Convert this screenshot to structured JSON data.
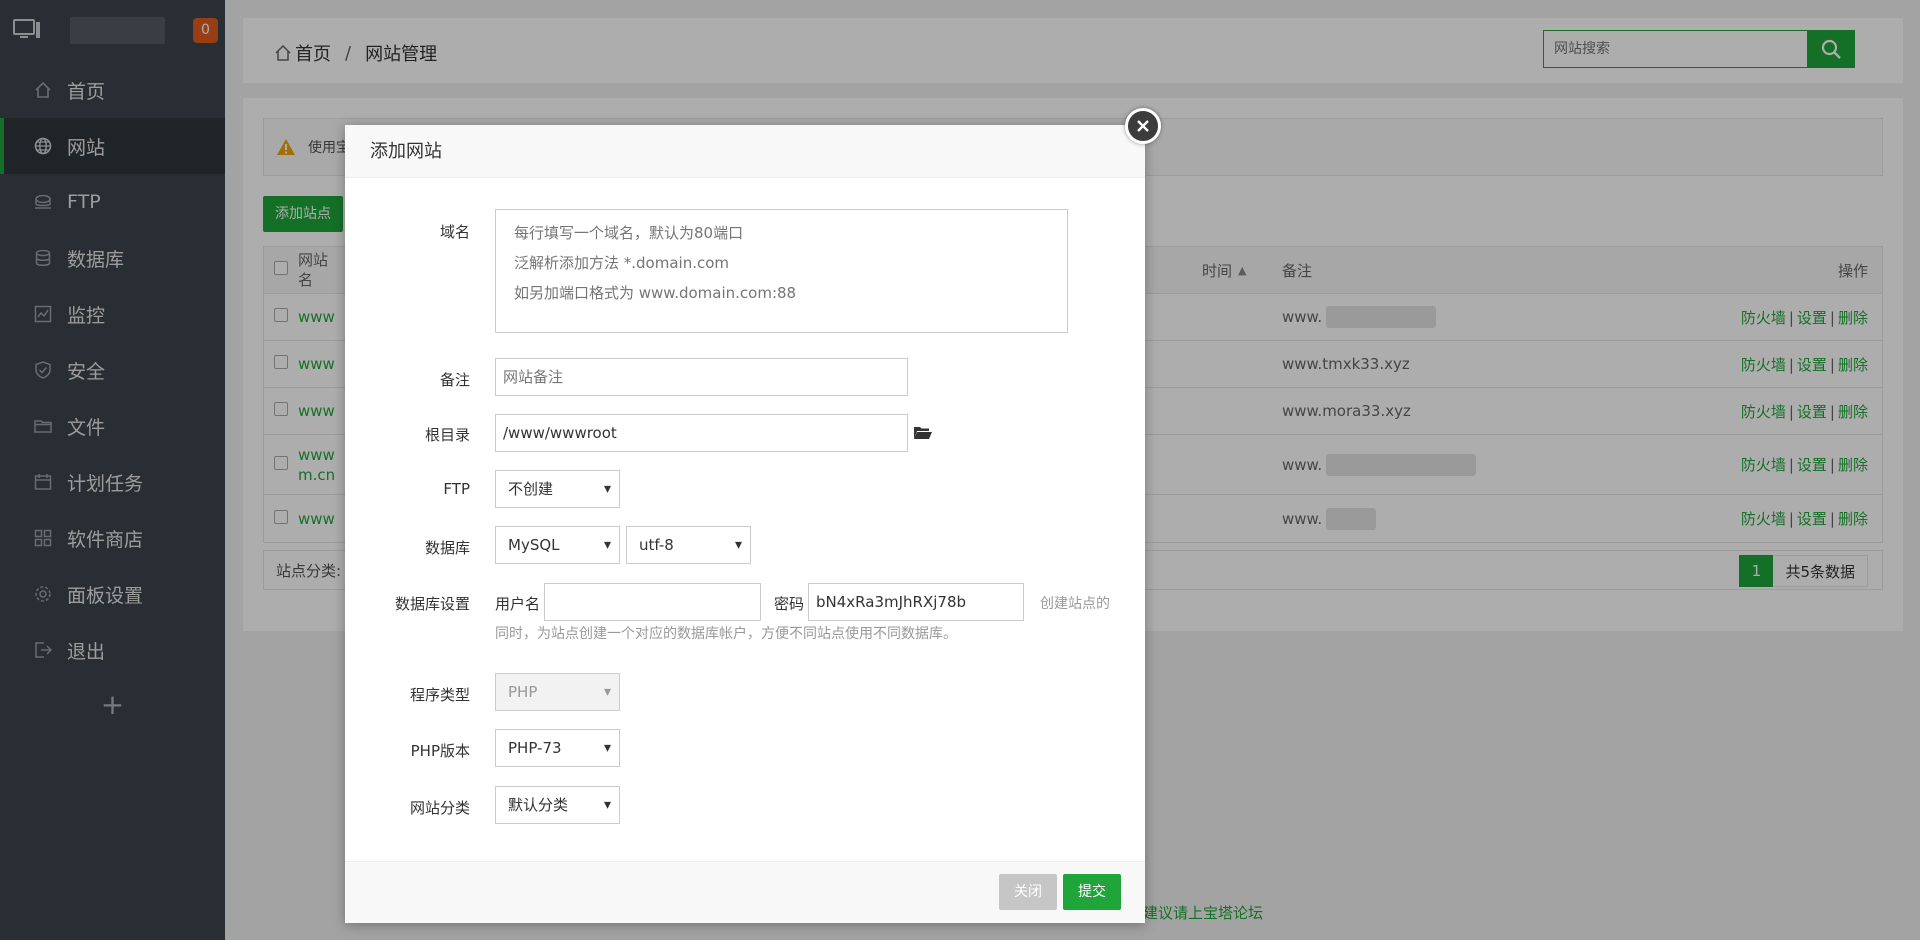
{
  "sidebar": {
    "badge": "0",
    "items": [
      {
        "label": "首页",
        "icon": "home-icon"
      },
      {
        "label": "网站",
        "icon": "globe-icon"
      },
      {
        "label": "FTP",
        "icon": "ftp-icon"
      },
      {
        "label": "数据库",
        "icon": "database-icon"
      },
      {
        "label": "监控",
        "icon": "monitor-icon"
      },
      {
        "label": "安全",
        "icon": "shield-icon"
      },
      {
        "label": "文件",
        "icon": "folder-icon"
      },
      {
        "label": "计划任务",
        "icon": "calendar-icon"
      },
      {
        "label": "软件商店",
        "icon": "grid-icon"
      },
      {
        "label": "面板设置",
        "icon": "gear-icon"
      },
      {
        "label": "退出",
        "icon": "logout-icon"
      }
    ],
    "plus": "+"
  },
  "header": {
    "breadcrumb_home": "首页",
    "breadcrumb_sep": "/",
    "breadcrumb_current": "网站管理",
    "search_placeholder": "网站搜索"
  },
  "content": {
    "alert_text": "使用宝",
    "add_site": "添加站点",
    "table": {
      "head_name": "网站名",
      "head_time": "时间",
      "head_remark": "备注",
      "head_ops": "操作",
      "rows": [
        {
          "name": "www",
          "remark": "www."
        },
        {
          "name": "www",
          "remark": "www.tmxk33.xyz"
        },
        {
          "name": "www",
          "remark": "www.mora33.xyz"
        },
        {
          "name": "www",
          "name2": "m.cn",
          "remark": "www."
        },
        {
          "name": "www",
          "remark": "www."
        }
      ],
      "op_firewall": "防火墙",
      "op_settings": "设置",
      "op_delete": "删除",
      "op_sep": "|"
    },
    "footer_label": "站点分类:",
    "page_num": "1",
    "page_total": "共5条数据"
  },
  "footer_link": "建议请上宝塔论坛",
  "modal": {
    "title": "添加网站",
    "domain_label": "域名",
    "domain_placeholder": "每行填写一个域名，默认为80端口\n泛解析添加方法 *.domain.com\n如另加端口格式为 www.domain.com:88",
    "remark_label": "备注",
    "remark_placeholder": "网站备注",
    "root_label": "根目录",
    "root_value": "/www/wwwroot",
    "ftp_label": "FTP",
    "ftp_value": "不创建",
    "db_label": "数据库",
    "db_value": "MySQL",
    "db_charset": "utf-8",
    "dbset_label": "数据库设置",
    "db_user_label": "用户名",
    "db_user_value": "",
    "db_pass_label": "密码",
    "db_pass_value": "bN4xRa3mJhRXj78b",
    "db_help_1": "创建站点的",
    "db_help_2": "同时，为站点创建一个对应的数据库帐户，方便不同站点使用不同数据库。",
    "type_label": "程序类型",
    "type_value": "PHP",
    "php_label": "PHP版本",
    "php_value": "PHP-73",
    "cat_label": "网站分类",
    "cat_value": "默认分类",
    "btn_close": "关闭",
    "btn_submit": "提交"
  },
  "colors": {
    "accent": "#20a53a",
    "sidebar": "#3c444d",
    "badge": "#e15b1e"
  }
}
